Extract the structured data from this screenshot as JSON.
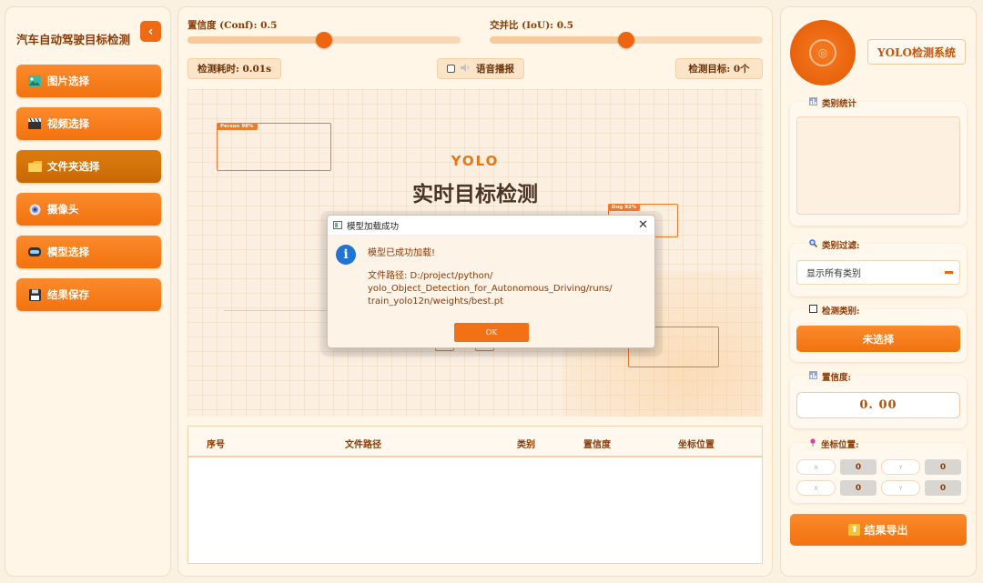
{
  "sidebar": {
    "title": "汽车自动驾驶目标检测",
    "collapse_icon": "‹",
    "buttons": [
      {
        "label": "图片选择",
        "icon": "image-icon"
      },
      {
        "label": "视频选择",
        "icon": "clapper-icon"
      },
      {
        "label": "文件夹选择",
        "icon": "folder-icon"
      },
      {
        "label": "摄像头",
        "icon": "camera-icon"
      },
      {
        "label": "模型选择",
        "icon": "model-icon"
      },
      {
        "label": "结果保存",
        "icon": "floppy-icon"
      }
    ],
    "active_index": 2
  },
  "controls": {
    "conf_label": "置信度 (Conf): 0.5",
    "conf_value": 0.5,
    "iou_label": "交并比 (IoU): 0.5",
    "iou_value": 0.5,
    "elapsed": "检测耗时: 0.01s",
    "voice": "语音播报",
    "target_count": "检测目标: 0个"
  },
  "canvas": {
    "heading": "YOLO",
    "subheading": "实时目标检测",
    "boxes": [
      {
        "label": "Person 98%"
      },
      {
        "label": "Dog 92%"
      }
    ]
  },
  "table": {
    "columns": [
      "序号",
      "文件路径",
      "类别",
      "置信度",
      "坐标位置"
    ]
  },
  "dialog": {
    "title": "模型加载成功",
    "close": "✕",
    "info_glyph": "i",
    "message": "模型已成功加载!",
    "path_line1": "文件路径: D:/project/python/",
    "path_line2": "yolo_Object_Detection_for_Autonomous_Driving/runs/",
    "path_line3": "train_yolo12n/weights/best.pt",
    "ok": "OK"
  },
  "right": {
    "system_title": "YOLO检测系统",
    "stats_label": "类别统计",
    "filter_label": "类别过滤:",
    "filter_value": "显示所有类别",
    "detect_class_label": "检测类别:",
    "detect_class_value": "未选择",
    "conf_label": "置信度:",
    "conf_value": "0. 00",
    "coord_label": "坐标位置:",
    "coords": [
      [
        {
          "key": "X",
          "val": "0"
        },
        {
          "key": "Y",
          "val": "0"
        }
      ],
      [
        {
          "key": "X",
          "val": "0"
        },
        {
          "key": "Y",
          "val": "0"
        }
      ]
    ],
    "export": "结果导出"
  },
  "colors": {
    "accent": "#f2720f",
    "accent_dark": "#c96906",
    "info_blue": "#1f74d6"
  }
}
